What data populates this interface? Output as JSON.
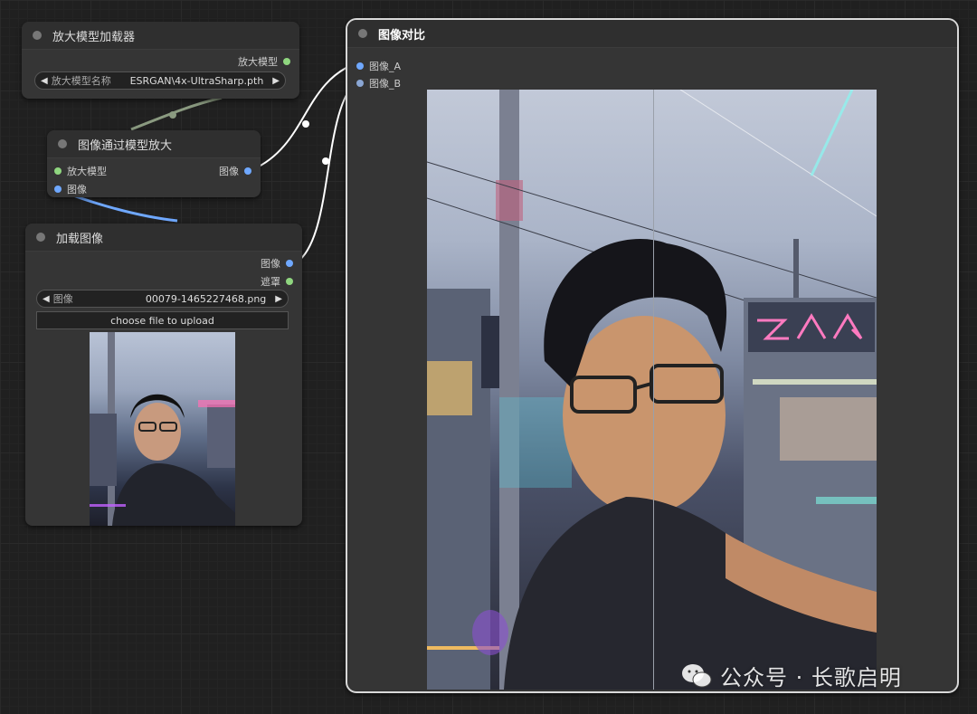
{
  "nodes": {
    "upscale_loader": {
      "title": "放大模型加载器",
      "output_label": "放大模型",
      "widget_label": "放大模型名称",
      "widget_value": "ESRGAN\\4x-UltraSharp.pth"
    },
    "upscale_by_model": {
      "title": "图像通过模型放大",
      "input_model": "放大模型",
      "input_image": "图像",
      "output_image": "图像"
    },
    "load_image": {
      "title": "加载图像",
      "output_image": "图像",
      "output_mask": "遮罩",
      "widget_label": "图像",
      "widget_value": "00079-1465227468.png",
      "upload_button": "choose file to upload"
    },
    "image_compare": {
      "title": "图像对比",
      "input_a": "图像_A",
      "input_b": "图像_B"
    }
  },
  "watermark": {
    "text": "公众号 · 长歌启明"
  },
  "colors": {
    "port_model": "#8fd67f",
    "port_image": "#6fa8ff",
    "link_image": "#ffffff",
    "link_model": "#8a9a80"
  }
}
